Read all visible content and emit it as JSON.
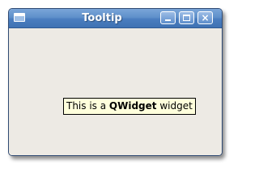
{
  "window": {
    "title": "Tooltip",
    "icons": {
      "system": "window-icon",
      "minimize": "minimize-icon",
      "maximize": "maximize-icon",
      "close": "close-icon"
    },
    "close_glyph": "×"
  },
  "tooltip": {
    "prefix": "This is a ",
    "bold": "QWidget",
    "suffix": " widget"
  },
  "colors": {
    "titlebar": "#4a7dbf",
    "client_background": "#edeae4",
    "tooltip_background": "#ffffdc"
  }
}
